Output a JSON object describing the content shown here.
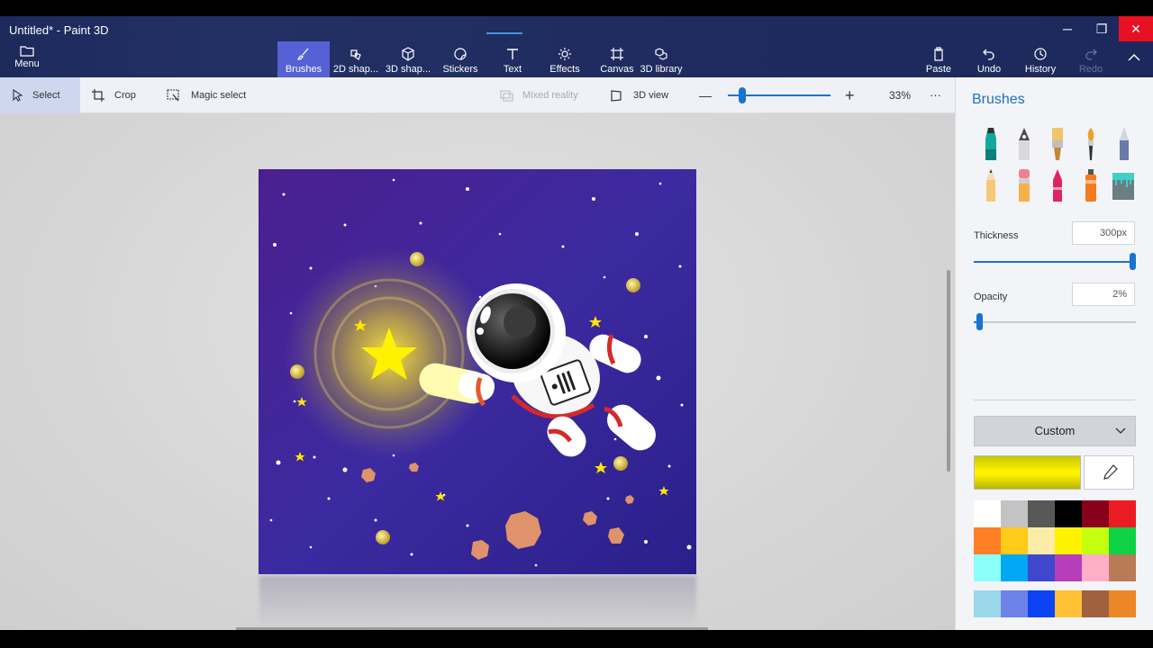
{
  "window": {
    "title": "Untitled* - Paint 3D",
    "minimize_glyph": "─",
    "restore_glyph": "❐",
    "close_glyph": "✕"
  },
  "menu": {
    "label": "Menu",
    "icon": "folder-icon"
  },
  "toolbar": [
    {
      "label": "Brushes",
      "icon": "brush-icon",
      "active": true
    },
    {
      "label": "2D shap...",
      "icon": "2d-shapes-icon"
    },
    {
      "label": "3D shap...",
      "icon": "3d-shapes-icon"
    },
    {
      "label": "Stickers",
      "icon": "sticker-icon"
    },
    {
      "label": "Text",
      "icon": "text-icon"
    },
    {
      "label": "Effects",
      "icon": "effects-icon"
    },
    {
      "label": "Canvas",
      "icon": "canvas-icon"
    },
    {
      "label": "3D library",
      "icon": "3d-library-icon"
    }
  ],
  "right_tools": [
    {
      "label": "Paste",
      "icon": "paste-icon",
      "enabled": true
    },
    {
      "label": "Undo",
      "icon": "undo-icon",
      "enabled": true
    },
    {
      "label": "History",
      "icon": "history-icon",
      "enabled": true
    },
    {
      "label": "Redo",
      "icon": "redo-icon",
      "enabled": false
    }
  ],
  "subbar": {
    "select": "Select",
    "crop": "Crop",
    "magic_select": "Magic select",
    "mixed_reality": "Mixed reality",
    "view3d": "3D view",
    "zoom": "33%",
    "zoom_minus": "—",
    "zoom_plus": "+",
    "more": "···"
  },
  "panel": {
    "title": "Brushes",
    "thickness_label": "Thickness",
    "thickness_value": "300px",
    "thickness_level": 1.0,
    "opacity_label": "Opacity",
    "opacity_value": "2%",
    "opacity_level": 0.02,
    "brush_type": "Custom",
    "current_color": "#fff200",
    "palette": [
      "#ffffff",
      "#c3c3c3",
      "#585858",
      "#000000",
      "#88001b",
      "#ec1c24",
      "#ff7f27",
      "#ffca18",
      "#fdeca6",
      "#fff200",
      "#c4ff0e",
      "#0ed145",
      "#8cfffb",
      "#00a8f3",
      "#3f48cc",
      "#b83dba",
      "#ffaec8",
      "#b97a56",
      "#99d9ea",
      "#6d82e8",
      "#0c43f5",
      "#ffc135",
      "#a0613f",
      "#ec8728"
    ]
  }
}
